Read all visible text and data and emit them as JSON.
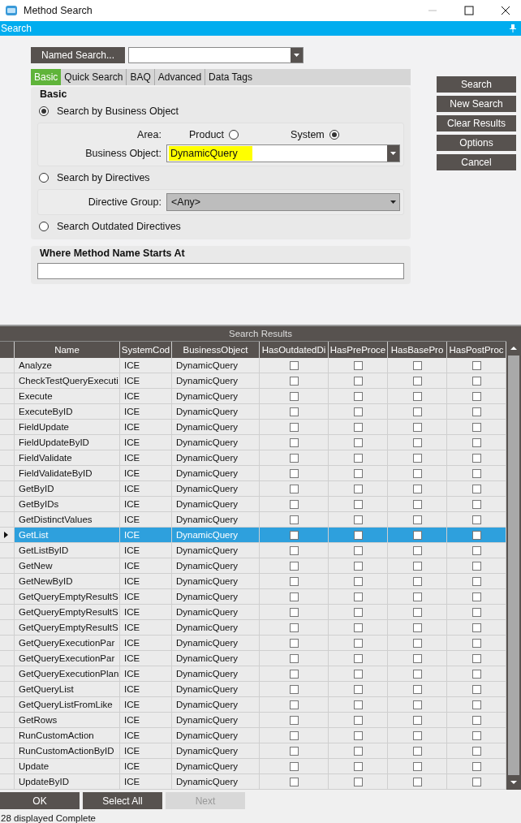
{
  "window": {
    "title": "Method Search"
  },
  "panel_title": "Search",
  "named_search": {
    "button": "Named Search..."
  },
  "tabs": [
    {
      "label": "Basic",
      "selected": true
    },
    {
      "label": "Quick Search",
      "selected": false
    },
    {
      "label": "BAQ",
      "selected": false
    },
    {
      "label": "Advanced",
      "selected": false
    },
    {
      "label": "Data Tags",
      "selected": false
    }
  ],
  "basic": {
    "title": "Basic",
    "by_business_object": {
      "label": "Search by Business Object",
      "selected": true
    },
    "area_label": "Area:",
    "areas": [
      {
        "label": "Product",
        "selected": false
      },
      {
        "label": "System",
        "selected": true
      }
    ],
    "business_object": {
      "label": "Business Object:",
      "value": "DynamicQuery",
      "highlighted": true
    },
    "by_directives": {
      "label": "Search by Directives",
      "selected": false
    },
    "directive_group": {
      "label": "Directive Group:",
      "value": "<Any>",
      "disabled": true
    },
    "outdated": {
      "label": "Search Outdated Directives",
      "selected": false
    }
  },
  "method_name": {
    "title": "Where Method Name Starts At"
  },
  "actions": [
    "Search",
    "New Search",
    "Clear Results",
    "Options",
    "Cancel"
  ],
  "results": {
    "title": "Search Results",
    "columns": [
      "Name",
      "SystemCod",
      "BusinessObject",
      "HasOutdatedDi",
      "HasPreProce",
      "HasBasePro",
      "HasPostProc"
    ],
    "rows": [
      {
        "name": "Analyze",
        "system": "ICE",
        "bo": "DynamicQuery",
        "checks": [
          false,
          false,
          false,
          false
        ],
        "selected": false
      },
      {
        "name": "CheckTestQueryExecuti",
        "system": "ICE",
        "bo": "DynamicQuery",
        "checks": [
          false,
          false,
          false,
          false
        ],
        "selected": false
      },
      {
        "name": "Execute",
        "system": "ICE",
        "bo": "DynamicQuery",
        "checks": [
          false,
          false,
          false,
          false
        ],
        "selected": false
      },
      {
        "name": "ExecuteByID",
        "system": "ICE",
        "bo": "DynamicQuery",
        "checks": [
          false,
          false,
          false,
          false
        ],
        "selected": false
      },
      {
        "name": "FieldUpdate",
        "system": "ICE",
        "bo": "DynamicQuery",
        "checks": [
          false,
          false,
          false,
          false
        ],
        "selected": false
      },
      {
        "name": "FieldUpdateByID",
        "system": "ICE",
        "bo": "DynamicQuery",
        "checks": [
          false,
          false,
          false,
          false
        ],
        "selected": false
      },
      {
        "name": "FieldValidate",
        "system": "ICE",
        "bo": "DynamicQuery",
        "checks": [
          false,
          false,
          false,
          false
        ],
        "selected": false
      },
      {
        "name": "FieldValidateByID",
        "system": "ICE",
        "bo": "DynamicQuery",
        "checks": [
          false,
          false,
          false,
          false
        ],
        "selected": false
      },
      {
        "name": "GetByID",
        "system": "ICE",
        "bo": "DynamicQuery",
        "checks": [
          false,
          false,
          false,
          false
        ],
        "selected": false
      },
      {
        "name": "GetByIDs",
        "system": "ICE",
        "bo": "DynamicQuery",
        "checks": [
          false,
          false,
          false,
          false
        ],
        "selected": false
      },
      {
        "name": "GetDistinctValues",
        "system": "ICE",
        "bo": "DynamicQuery",
        "checks": [
          false,
          false,
          false,
          false
        ],
        "selected": false
      },
      {
        "name": "GetList",
        "system": "ICE",
        "bo": "DynamicQuery",
        "checks": [
          false,
          false,
          false,
          false
        ],
        "selected": true
      },
      {
        "name": "GetListByID",
        "system": "ICE",
        "bo": "DynamicQuery",
        "checks": [
          false,
          false,
          false,
          false
        ],
        "selected": false
      },
      {
        "name": "GetNew",
        "system": "ICE",
        "bo": "DynamicQuery",
        "checks": [
          false,
          false,
          false,
          false
        ],
        "selected": false
      },
      {
        "name": "GetNewByID",
        "system": "ICE",
        "bo": "DynamicQuery",
        "checks": [
          false,
          false,
          false,
          false
        ],
        "selected": false
      },
      {
        "name": "GetQueryEmptyResultS",
        "system": "ICE",
        "bo": "DynamicQuery",
        "checks": [
          false,
          false,
          false,
          false
        ],
        "selected": false
      },
      {
        "name": "GetQueryEmptyResultS",
        "system": "ICE",
        "bo": "DynamicQuery",
        "checks": [
          false,
          false,
          false,
          false
        ],
        "selected": false
      },
      {
        "name": "GetQueryEmptyResultS",
        "system": "ICE",
        "bo": "DynamicQuery",
        "checks": [
          false,
          false,
          false,
          false
        ],
        "selected": false
      },
      {
        "name": "GetQueryExecutionPar",
        "system": "ICE",
        "bo": "DynamicQuery",
        "checks": [
          false,
          false,
          false,
          false
        ],
        "selected": false
      },
      {
        "name": "GetQueryExecutionPar",
        "system": "ICE",
        "bo": "DynamicQuery",
        "checks": [
          false,
          false,
          false,
          false
        ],
        "selected": false
      },
      {
        "name": "GetQueryExecutionPlan",
        "system": "ICE",
        "bo": "DynamicQuery",
        "checks": [
          false,
          false,
          false,
          false
        ],
        "selected": false
      },
      {
        "name": "GetQueryList",
        "system": "ICE",
        "bo": "DynamicQuery",
        "checks": [
          false,
          false,
          false,
          false
        ],
        "selected": false
      },
      {
        "name": "GetQueryListFromLike",
        "system": "ICE",
        "bo": "DynamicQuery",
        "checks": [
          false,
          false,
          false,
          false
        ],
        "selected": false
      },
      {
        "name": "GetRows",
        "system": "ICE",
        "bo": "DynamicQuery",
        "checks": [
          false,
          false,
          false,
          false
        ],
        "selected": false
      },
      {
        "name": "RunCustomAction",
        "system": "ICE",
        "bo": "DynamicQuery",
        "checks": [
          false,
          false,
          false,
          false
        ],
        "selected": false
      },
      {
        "name": "RunCustomActionByID",
        "system": "ICE",
        "bo": "DynamicQuery",
        "checks": [
          false,
          false,
          false,
          false
        ],
        "selected": false
      },
      {
        "name": "Update",
        "system": "ICE",
        "bo": "DynamicQuery",
        "checks": [
          false,
          false,
          false,
          false
        ],
        "selected": false
      },
      {
        "name": "UpdateByID",
        "system": "ICE",
        "bo": "DynamicQuery",
        "checks": [
          false,
          false,
          false,
          false
        ],
        "selected": false
      }
    ]
  },
  "bottom_buttons": [
    {
      "label": "OK",
      "disabled": false
    },
    {
      "label": "Select All",
      "disabled": false
    },
    {
      "label": "Next",
      "disabled": true
    }
  ],
  "status_bar": "28 displayed Complete"
}
